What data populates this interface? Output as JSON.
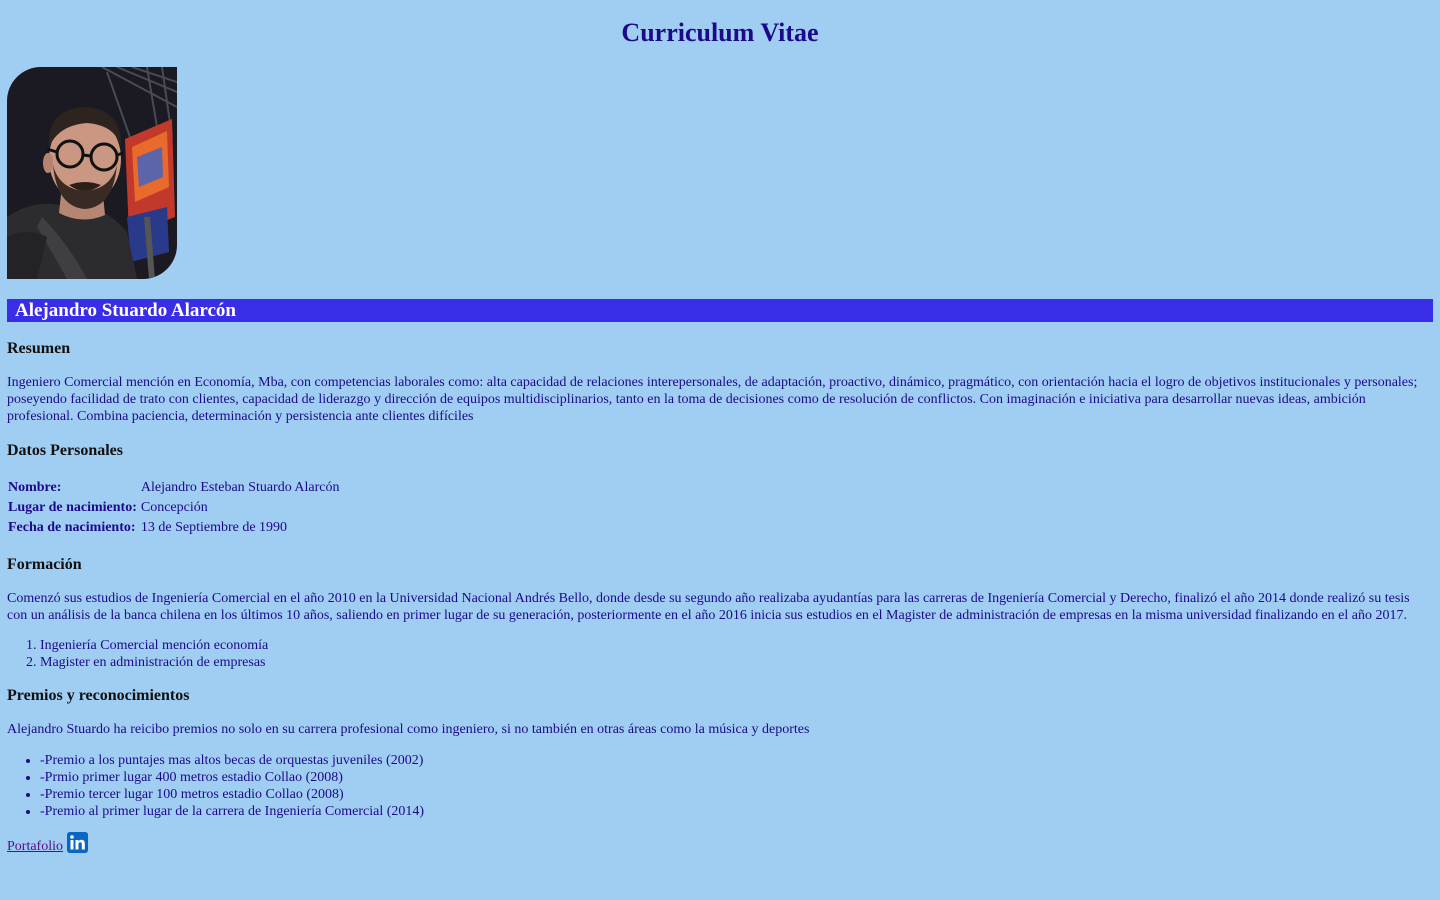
{
  "page": {
    "title": "Curriculum Vitae"
  },
  "profile": {
    "name": "Alejandro Stuardo Alarcón",
    "photo_alt": "Alejandro Stuardo selfie"
  },
  "resumen": {
    "heading": "Resumen",
    "text": "Ingeniero Comercial mención en Economía, Mba, con competencias laborales como: alta capacidad de relaciones interepersonales, de adaptación, proactivo, dinámico, pragmático, con orientación hacia el logro de objetivos institucionales y personales; poseyendo facilidad de trato con clientes, capacidad de liderazgo y dirección de equipos multidisciplinarios, tanto en la toma de decisiones como de resolución de conflictos. Con imaginación e iniciativa para desarrollar nuevas ideas, ambición profesional. Combina paciencia, determinación y persistencia ante clientes difíciles"
  },
  "datos": {
    "heading": "Datos Personales",
    "rows": [
      {
        "label": "Nombre:",
        "value": "Alejandro Esteban Stuardo Alarcón"
      },
      {
        "label": "Lugar de nacimiento:",
        "value": "Concepción"
      },
      {
        "label": "Fecha de nacimiento:",
        "value": "13 de Septiembre de 1990"
      }
    ]
  },
  "formacion": {
    "heading": "Formación",
    "text": "Comenzó sus estudios de Ingeniería Comercial en el año 2010 en la Universidad Nacional Andrés Bello, donde desde su segundo año realizaba ayudantías para las carreras de Ingeniería Comercial y Derecho, finalizó el año 2014 donde realizó su tesis con un análisis de la banca chilena en los últimos 10 años, saliendo en primer lugar de su generación, posteriormente en el año 2016 inicia sus estudios en el Magister de administración de empresas en la misma universidad finalizando en el año 2017.",
    "items": [
      "Ingeniería Comercial mención economía",
      "Magister en administración de empresas"
    ]
  },
  "premios": {
    "heading": "Premios y reconocimientos",
    "text": "Alejandro Stuardo ha reicibo premios no solo en su carrera profesional como ingeniero, si no también en otras áreas como la música y deportes",
    "items": [
      "-Premio a los puntajes mas altos becas de orquestas juveniles (2002)",
      "-Prmio primer lugar 400 metros estadio Collao (2008)",
      "-Premio tercer lugar 100 metros estadio Collao (2008)",
      "-Premio al primer lugar de la carrera de Ingeniería Comercial (2014)"
    ]
  },
  "footer": {
    "portfolio_label": "Portafolio",
    "linkedin_icon": "linkedin-icon",
    "linkedin_text": "in"
  },
  "colors": {
    "background": "#a0cdf2",
    "text": "#1c0a8a",
    "name_bar": "#3a2de8",
    "link": "#5a0a8a",
    "linkedin": "#0a66c2"
  }
}
